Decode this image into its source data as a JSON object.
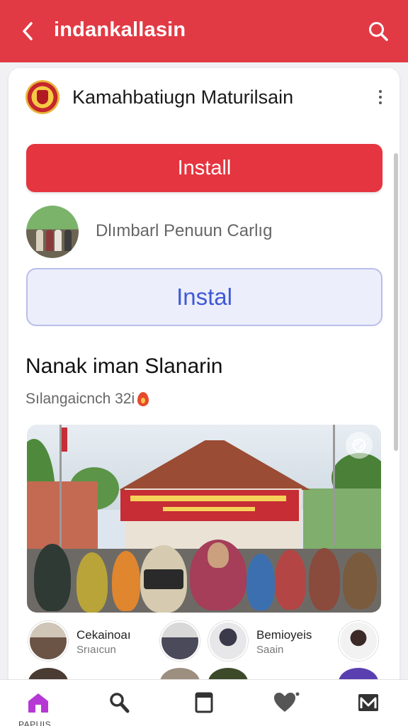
{
  "header": {
    "title": "indankallasin"
  },
  "app": {
    "name": "Kamahbatiugn Maturilsain",
    "install_label": "Install"
  },
  "community": {
    "label": "Dlımbarl Penuun Carlıg",
    "install_label": "Instal"
  },
  "section": {
    "title": "Nanak iman Slanarin",
    "subtitle": "Sılangaicnch 32i"
  },
  "groups": [
    {
      "name": "Cekainoaı",
      "sub": "Srıaıcun"
    },
    {
      "name": "Bemioyeis",
      "sub": "Saain"
    }
  ],
  "bottom_nav": {
    "active_label": "PAPUIS"
  },
  "colors": {
    "primary": "#e23a44",
    "install_button": "#e53540",
    "secondary_fill": "#eceefb",
    "secondary_text": "#3f59d6",
    "nav_active": "#b637d4"
  },
  "icons": [
    "back-arrow-icon",
    "search-icon",
    "more-vertical-icon",
    "fire-icon",
    "scan-icon",
    "home-icon",
    "search-nav-icon",
    "bookmark-icon",
    "heart-icon",
    "mail-icon"
  ]
}
